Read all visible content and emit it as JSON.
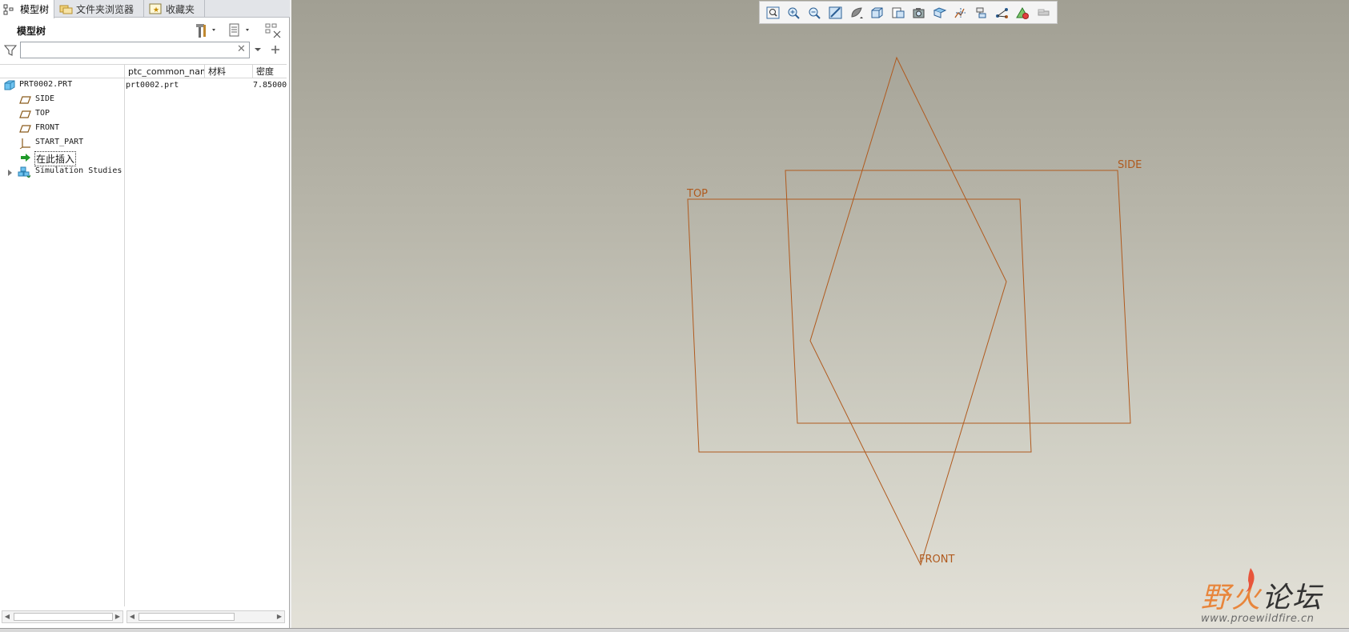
{
  "tabs": [
    {
      "label": "模型树",
      "icon": "model-tree-icon"
    },
    {
      "label": "文件夹浏览器",
      "icon": "folder-browser-icon"
    },
    {
      "label": "收藏夹",
      "icon": "favorites-icon"
    }
  ],
  "tree": {
    "title": "模型树",
    "search_placeholder": "",
    "search_value": "",
    "columns": [
      "ptc_common_name",
      "材料",
      "密度"
    ],
    "rows": [
      {
        "label": "PRT0002.PRT",
        "icon": "part-icon",
        "common_name": "prt0002.prt",
        "density": "7.85000"
      },
      {
        "label": "SIDE",
        "icon": "datum-plane-icon"
      },
      {
        "label": "TOP",
        "icon": "datum-plane-icon"
      },
      {
        "label": "FRONT",
        "icon": "datum-plane-icon"
      },
      {
        "label": "START_PART",
        "icon": "coordinate-system-icon"
      },
      {
        "label": "在此插入",
        "icon": "insert-here-arrow-icon"
      },
      {
        "label": "Simulation Studies",
        "icon": "simulation-icon"
      }
    ]
  },
  "view_toolbar": [
    "refit-icon",
    "zoom-in-icon",
    "zoom-out-icon",
    "repaint-icon",
    "display-style-icon",
    "saved-orientations-icon",
    "view-manager-icon",
    "perspective-icon",
    "section-icon",
    "datum-display-icon",
    "plane-display-icon",
    "axis-display-icon",
    "point-display-icon",
    "annotation-display-icon",
    "spin-center-icon"
  ],
  "viewport": {
    "planes": {
      "side": "SIDE",
      "top": "TOP",
      "front": "FRONT"
    },
    "plane_color": "#b05a1e"
  },
  "watermark": {
    "part1": "野火",
    "part2": "论坛",
    "url": "www.proewildfire.cn"
  }
}
